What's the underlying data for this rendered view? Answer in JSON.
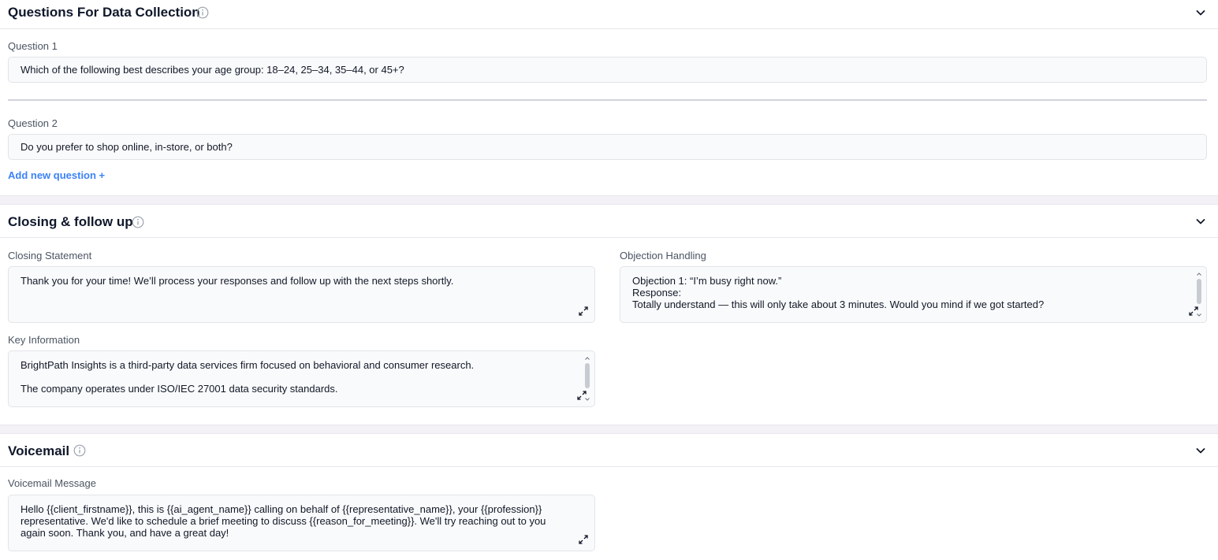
{
  "data_collection": {
    "title": "Questions For Data Collection",
    "questions": [
      {
        "label": "Question 1",
        "value": "Which of the following best describes your age group: 18–24, 25–34, 35–44, or 45+?"
      },
      {
        "label": "Question 2",
        "value": "Do you prefer to shop online, in-store, or both?"
      }
    ],
    "add_label": "Add new question +"
  },
  "closing": {
    "title": "Closing & follow up",
    "closing_statement": {
      "label": "Closing Statement",
      "value": "Thank you for your time! We’ll process your responses and follow up with the next steps shortly."
    },
    "objection_handling": {
      "label": "Objection Handling",
      "lines": [
        "Objection 1: “I’m busy right now.”",
        "Response:",
        "Totally understand — this will only take about 3 minutes. Would you mind if we got started?"
      ]
    },
    "key_information": {
      "label": "Key Information",
      "lines": [
        "BrightPath Insights is a third-party data services firm focused on behavioral and consumer research.",
        "",
        "The company operates under ISO/IEC 27001 data security standards."
      ]
    }
  },
  "voicemail": {
    "title": "Voicemail",
    "message": {
      "label": "Voicemail Message",
      "value": "Hello {{client_firstname}}, this is {{ai_agent_name}} calling on behalf of {{representative_name}}, your {{profession}} representative. We'd like to schedule a brief meeting to discuss {{reason_for_meeting}}. We'll try reaching out to you again soon. Thank you, and have a great day!"
    }
  },
  "icons": {
    "info": "info-circle-icon",
    "chevron": "chevron-down-icon",
    "expand": "expand-arrows-icon"
  },
  "colors": {
    "link": "#3b82f6",
    "field_bg": "#f9fafb",
    "band": "#f3f1f5"
  }
}
